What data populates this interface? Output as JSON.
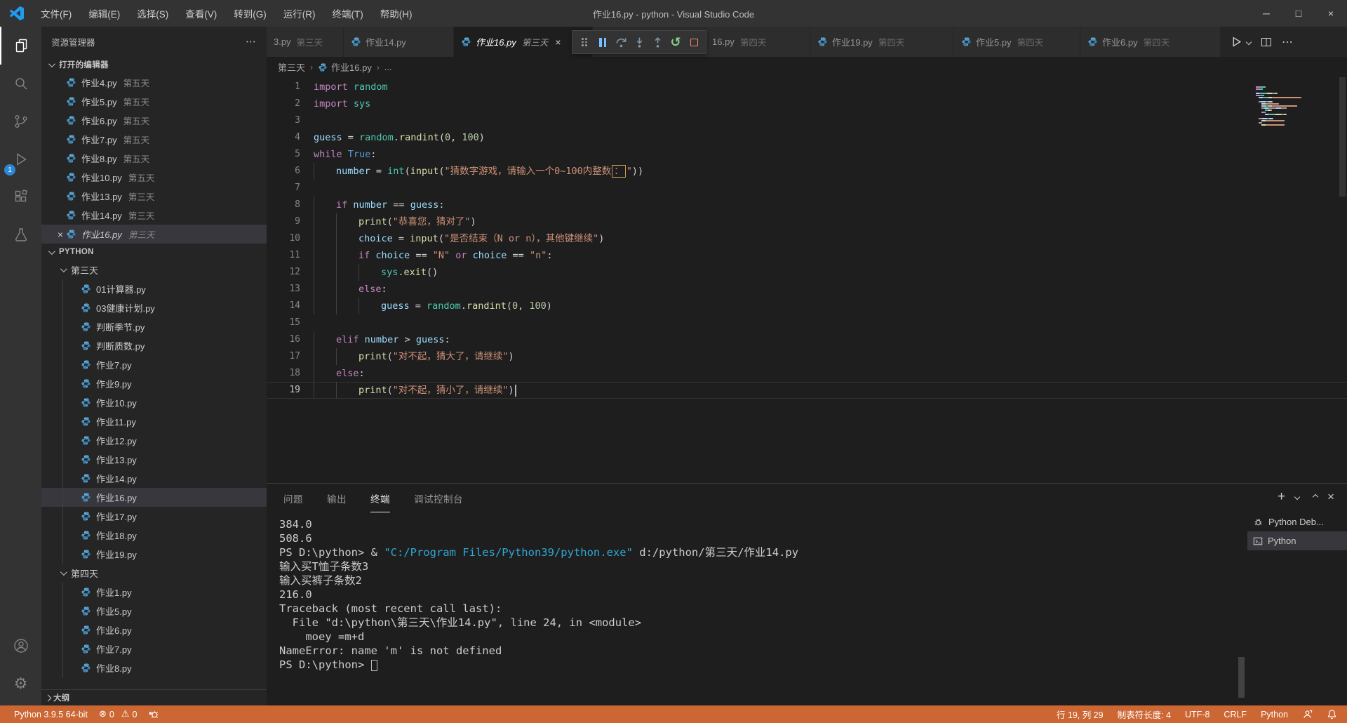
{
  "colors": {
    "statusbar_bg": "#cc6633",
    "accent_blue": "#2b88d8",
    "tab_active_bg": "#1e1e1e",
    "sidebar_bg": "#252526",
    "debug_pause": "#75beff",
    "debug_step": "#7e96a8",
    "debug_restart": "#89d185",
    "debug_stop": "#f48771",
    "kw": "#c586c0",
    "ty": "#4ec9b0",
    "fn": "#dcdcaa",
    "vr": "#9cdcfe",
    "cb": "#569cd6",
    "nm": "#b5cea8",
    "st": "#ce9178",
    "pl": "#d4d4d4"
  },
  "titlebar": {
    "menus": [
      "文件(F)",
      "编辑(E)",
      "选择(S)",
      "查看(V)",
      "转到(G)",
      "运行(R)",
      "终端(T)",
      "帮助(H)"
    ],
    "title": "作业16.py - python - Visual Studio Code",
    "window_controls": {
      "minimize": "─",
      "maximize": "□",
      "close": "×"
    }
  },
  "activitybar": {
    "badge": "1"
  },
  "sidebar": {
    "header": "资源管理器",
    "header_more": "⋯",
    "open_editors": {
      "label": "打开的编辑器",
      "items": [
        {
          "name": "作业4.py",
          "tag": "第五天"
        },
        {
          "name": "作业5.py",
          "tag": "第五天"
        },
        {
          "name": "作业6.py",
          "tag": "第五天"
        },
        {
          "name": "作业7.py",
          "tag": "第五天"
        },
        {
          "name": "作业8.py",
          "tag": "第五天"
        },
        {
          "name": "作业10.py",
          "tag": "第五天"
        },
        {
          "name": "作业13.py",
          "tag": "第三天"
        },
        {
          "name": "作业14.py",
          "tag": "第三天"
        },
        {
          "name": "作业16.py",
          "tag": "第三天",
          "selected": true,
          "italic": true,
          "close": "×"
        }
      ]
    },
    "workspace": {
      "label": "PYTHON",
      "folders": [
        {
          "name": "第三天",
          "items": [
            "01计算器.py",
            "03健康计划.py",
            "判断季节.py",
            "判断质数.py",
            "作业7.py",
            "作业9.py",
            "作业10.py",
            "作业11.py",
            "作业12.py",
            "作业13.py",
            "作业14.py",
            "作业16.py",
            "作业17.py",
            "作业18.py",
            "作业19.py"
          ],
          "selected": "作业16.py"
        },
        {
          "name": "第四天",
          "items": [
            "作业1.py",
            "作业5.py",
            "作业6.py",
            "作业7.py",
            "作业8.py"
          ]
        }
      ]
    },
    "outline": {
      "label": "大纲"
    }
  },
  "tabs": [
    {
      "label": "3.py",
      "tag": "第三天",
      "icon": false
    },
    {
      "label": "作业14.py",
      "icon": true
    },
    {
      "label": "作业16.py",
      "tag": "第三天",
      "icon": true,
      "active": true,
      "close": "×"
    },
    {
      "label": "16.py",
      "tag": "第四天",
      "icon": false
    },
    {
      "label": "作业19.py",
      "tag": "第四天",
      "icon": true
    },
    {
      "label": "作业5.py",
      "tag": "第四天",
      "icon": true
    },
    {
      "label": "作业6.py",
      "tag": "第四天",
      "icon": true
    }
  ],
  "tab_actions": {
    "more": "⋯"
  },
  "breadcrumb": [
    "第三天",
    "作业16.py",
    "..."
  ],
  "editor": {
    "lines": [
      {
        "n": 1,
        "ind": 0,
        "t": [
          {
            "s": "import",
            "c": "kw"
          },
          {
            "s": " ",
            "c": "pl"
          },
          {
            "s": "random",
            "c": "ty"
          }
        ]
      },
      {
        "n": 2,
        "ind": 0,
        "t": [
          {
            "s": "import",
            "c": "kw"
          },
          {
            "s": " ",
            "c": "pl"
          },
          {
            "s": "sys",
            "c": "ty"
          }
        ]
      },
      {
        "n": 3,
        "ind": 0,
        "t": []
      },
      {
        "n": 4,
        "ind": 0,
        "t": [
          {
            "s": "guess",
            "c": "vr"
          },
          {
            "s": " = ",
            "c": "pl"
          },
          {
            "s": "random",
            "c": "ty"
          },
          {
            "s": ".",
            "c": "pl"
          },
          {
            "s": "randint",
            "c": "fn"
          },
          {
            "s": "(",
            "c": "pl"
          },
          {
            "s": "0",
            "c": "nm"
          },
          {
            "s": ", ",
            "c": "pl"
          },
          {
            "s": "100",
            "c": "nm"
          },
          {
            "s": ")",
            "c": "pl"
          }
        ]
      },
      {
        "n": 5,
        "ind": 0,
        "t": [
          {
            "s": "while",
            "c": "kw"
          },
          {
            "s": " ",
            "c": "pl"
          },
          {
            "s": "True",
            "c": "cb"
          },
          {
            "s": ":",
            "c": "pl"
          }
        ]
      },
      {
        "n": 6,
        "ind": 1,
        "t": [
          {
            "s": "number",
            "c": "vr"
          },
          {
            "s": " = ",
            "c": "pl"
          },
          {
            "s": "int",
            "c": "ty"
          },
          {
            "s": "(",
            "c": "pl"
          },
          {
            "s": "input",
            "c": "fn"
          },
          {
            "s": "(",
            "c": "pl"
          },
          {
            "s": "\"猜数字游戏，请输入一个0~100内整数",
            "c": "st"
          },
          {
            "s": "：",
            "c": "sbox"
          },
          {
            "s": "\"",
            "c": "st"
          },
          {
            "s": "))",
            "c": "pl"
          }
        ]
      },
      {
        "n": 7,
        "ind": 0,
        "t": []
      },
      {
        "n": 8,
        "ind": 1,
        "t": [
          {
            "s": "if",
            "c": "kw"
          },
          {
            "s": " ",
            "c": "pl"
          },
          {
            "s": "number",
            "c": "vr"
          },
          {
            "s": " == ",
            "c": "pl"
          },
          {
            "s": "guess",
            "c": "vr"
          },
          {
            "s": ":",
            "c": "pl"
          }
        ]
      },
      {
        "n": 9,
        "ind": 2,
        "t": [
          {
            "s": "print",
            "c": "fn"
          },
          {
            "s": "(",
            "c": "pl"
          },
          {
            "s": "\"恭喜您，猜对了\"",
            "c": "st"
          },
          {
            "s": ")",
            "c": "pl"
          }
        ]
      },
      {
        "n": 10,
        "ind": 2,
        "t": [
          {
            "s": "choice",
            "c": "vr"
          },
          {
            "s": " = ",
            "c": "pl"
          },
          {
            "s": "input",
            "c": "fn"
          },
          {
            "s": "(",
            "c": "pl"
          },
          {
            "s": "\"是否结束（N or n），其他键继续\"",
            "c": "st"
          },
          {
            "s": ")",
            "c": "pl"
          }
        ]
      },
      {
        "n": 11,
        "ind": 2,
        "t": [
          {
            "s": "if",
            "c": "kw"
          },
          {
            "s": " ",
            "c": "pl"
          },
          {
            "s": "choice",
            "c": "vr"
          },
          {
            "s": " == ",
            "c": "pl"
          },
          {
            "s": "\"N\"",
            "c": "st"
          },
          {
            "s": " ",
            "c": "pl"
          },
          {
            "s": "or",
            "c": "kw"
          },
          {
            "s": " ",
            "c": "pl"
          },
          {
            "s": "choice",
            "c": "vr"
          },
          {
            "s": " == ",
            "c": "pl"
          },
          {
            "s": "\"n\"",
            "c": "st"
          },
          {
            "s": ":",
            "c": "pl"
          }
        ]
      },
      {
        "n": 12,
        "ind": 3,
        "t": [
          {
            "s": "sys",
            "c": "ty"
          },
          {
            "s": ".",
            "c": "pl"
          },
          {
            "s": "exit",
            "c": "fn"
          },
          {
            "s": "()",
            "c": "pl"
          }
        ]
      },
      {
        "n": 13,
        "ind": 2,
        "t": [
          {
            "s": "else",
            "c": "kw"
          },
          {
            "s": ":",
            "c": "pl"
          }
        ]
      },
      {
        "n": 14,
        "ind": 3,
        "t": [
          {
            "s": "guess",
            "c": "vr"
          },
          {
            "s": " = ",
            "c": "pl"
          },
          {
            "s": "random",
            "c": "ty"
          },
          {
            "s": ".",
            "c": "pl"
          },
          {
            "s": "randint",
            "c": "fn"
          },
          {
            "s": "(",
            "c": "pl"
          },
          {
            "s": "0",
            "c": "nm"
          },
          {
            "s": ", ",
            "c": "pl"
          },
          {
            "s": "100",
            "c": "nm"
          },
          {
            "s": ")",
            "c": "pl"
          }
        ]
      },
      {
        "n": 15,
        "ind": 0,
        "t": []
      },
      {
        "n": 16,
        "ind": 1,
        "t": [
          {
            "s": "elif",
            "c": "kw"
          },
          {
            "s": " ",
            "c": "pl"
          },
          {
            "s": "number",
            "c": "vr"
          },
          {
            "s": " > ",
            "c": "pl"
          },
          {
            "s": "guess",
            "c": "vr"
          },
          {
            "s": ":",
            "c": "pl"
          }
        ]
      },
      {
        "n": 17,
        "ind": 2,
        "t": [
          {
            "s": "print",
            "c": "fn"
          },
          {
            "s": "(",
            "c": "pl"
          },
          {
            "s": "\"对不起，猜大了，请继续\"",
            "c": "st"
          },
          {
            "s": ")",
            "c": "pl"
          }
        ]
      },
      {
        "n": 18,
        "ind": 1,
        "t": [
          {
            "s": "else",
            "c": "kw"
          },
          {
            "s": ":",
            "c": "pl"
          }
        ]
      },
      {
        "n": 19,
        "ind": 2,
        "current": true,
        "cursor": true,
        "t": [
          {
            "s": "print",
            "c": "fn"
          },
          {
            "s": "(",
            "c": "pl"
          },
          {
            "s": "\"对不起，猜小了，请继续\"",
            "c": "st"
          },
          {
            "s": ")",
            "c": "pl"
          }
        ]
      }
    ]
  },
  "panel": {
    "tabs": [
      {
        "label": "问题"
      },
      {
        "label": "输出"
      },
      {
        "label": "终端",
        "active": true
      },
      {
        "label": "调试控制台"
      }
    ],
    "terminal_lines": [
      [
        {
          "s": "384.0"
        }
      ],
      [
        {
          "s": "508.6"
        }
      ],
      [
        {
          "s": "PS D:\\python> & "
        },
        {
          "s": "\"C:/Program Files/Python39/python.exe\"",
          "c": "cyan"
        },
        {
          "s": " d:/python/第三天/作业14.py"
        }
      ],
      [
        {
          "s": "输入买T恤子条数3"
        }
      ],
      [
        {
          "s": "输入买裤子条数2"
        }
      ],
      [
        {
          "s": "216.0"
        }
      ],
      [
        {
          "s": "Traceback (most recent call last):"
        }
      ],
      [
        {
          "s": "  File \"d:\\python\\第三天\\作业14.py\", line 24, in <module>"
        }
      ],
      [
        {
          "s": "    moey =m+d"
        }
      ],
      [
        {
          "s": "NameError: name 'm' is not defined"
        }
      ],
      [
        {
          "s": "PS D:\\python> "
        },
        {
          "s": "",
          "c": "tcursor"
        }
      ]
    ],
    "terminal_list": [
      {
        "icon": "debug",
        "label": "Python Deb..."
      },
      {
        "icon": "terminal",
        "label": "Python",
        "selected": true
      }
    ]
  },
  "statusbar": {
    "python_version": "Python 3.9.5 64-bit",
    "errors": "0",
    "warnings": "0",
    "error_glyph": "⊗",
    "warning_glyph": "⚠",
    "right_items": [
      "行 19, 列 29",
      "制表符长度: 4",
      "UTF-8",
      "CRLF",
      "Python"
    ]
  }
}
